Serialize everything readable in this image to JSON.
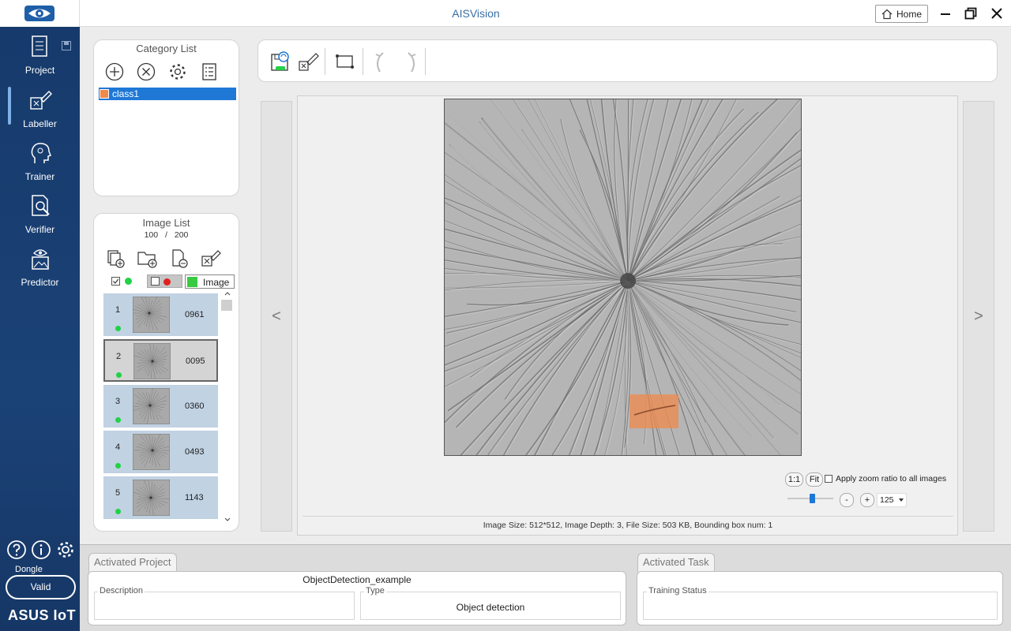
{
  "app": {
    "title": "AISVision",
    "home_label": "Home",
    "colors": {
      "sidebar": "#163a6b",
      "accent": "#1f78d6",
      "label_box": "#f08a4b",
      "labeled_dot": "#22d145",
      "unlabeled_dot": "#e02020"
    }
  },
  "sidebar": {
    "items": [
      {
        "label": "Project",
        "icon": "project-icon"
      },
      {
        "label": "Labeller",
        "icon": "labeller-icon",
        "active": true
      },
      {
        "label": "Trainer",
        "icon": "trainer-icon"
      },
      {
        "label": "Verifier",
        "icon": "verifier-icon"
      },
      {
        "label": "Predictor",
        "icon": "predictor-icon"
      }
    ],
    "dongle_label": "Dongle",
    "dongle_status": "Valid",
    "brand": "ASUS IoT"
  },
  "category_panel": {
    "title": "Category List",
    "tools": [
      "add-icon",
      "remove-icon",
      "settings-icon",
      "list-icon"
    ],
    "items": [
      {
        "name": "class1",
        "color": "#f08a4b"
      }
    ]
  },
  "image_panel": {
    "title": "Image List",
    "current": "100",
    "separator": "/",
    "total": "200",
    "tools": [
      "add-files-icon",
      "add-folder-icon",
      "remove-file-icon",
      "clear-labels-icon"
    ],
    "filter_label": "Image",
    "images": [
      {
        "index": "1",
        "name": "0961",
        "selected": false
      },
      {
        "index": "2",
        "name": "0095",
        "selected": true
      },
      {
        "index": "3",
        "name": "0360",
        "selected": false
      },
      {
        "index": "4",
        "name": "0493",
        "selected": false
      },
      {
        "index": "5",
        "name": "1143",
        "selected": false
      }
    ]
  },
  "viewer": {
    "zoom_1to1": "1:1",
    "zoom_fit": "Fit",
    "apply_zoom_label": "Apply zoom ratio to all images",
    "zoom_minus": "-",
    "zoom_plus": "+",
    "zoom_value": "125",
    "zoom_slider_fraction": 0.55,
    "prev_arrow": "<",
    "next_arrow": ">",
    "status": "Image Size: 512*512, Image Depth: 3, File Size: 503 KB, Bounding box num: 1"
  },
  "bottom": {
    "project_tab": "Activated Project",
    "project_name": "ObjectDetection_example",
    "description_label": "Description",
    "description_value": "",
    "type_label": "Type",
    "type_value": "Object detection",
    "task_tab": "Activated Task",
    "training_status_label": "Training Status",
    "training_status_value": ""
  }
}
